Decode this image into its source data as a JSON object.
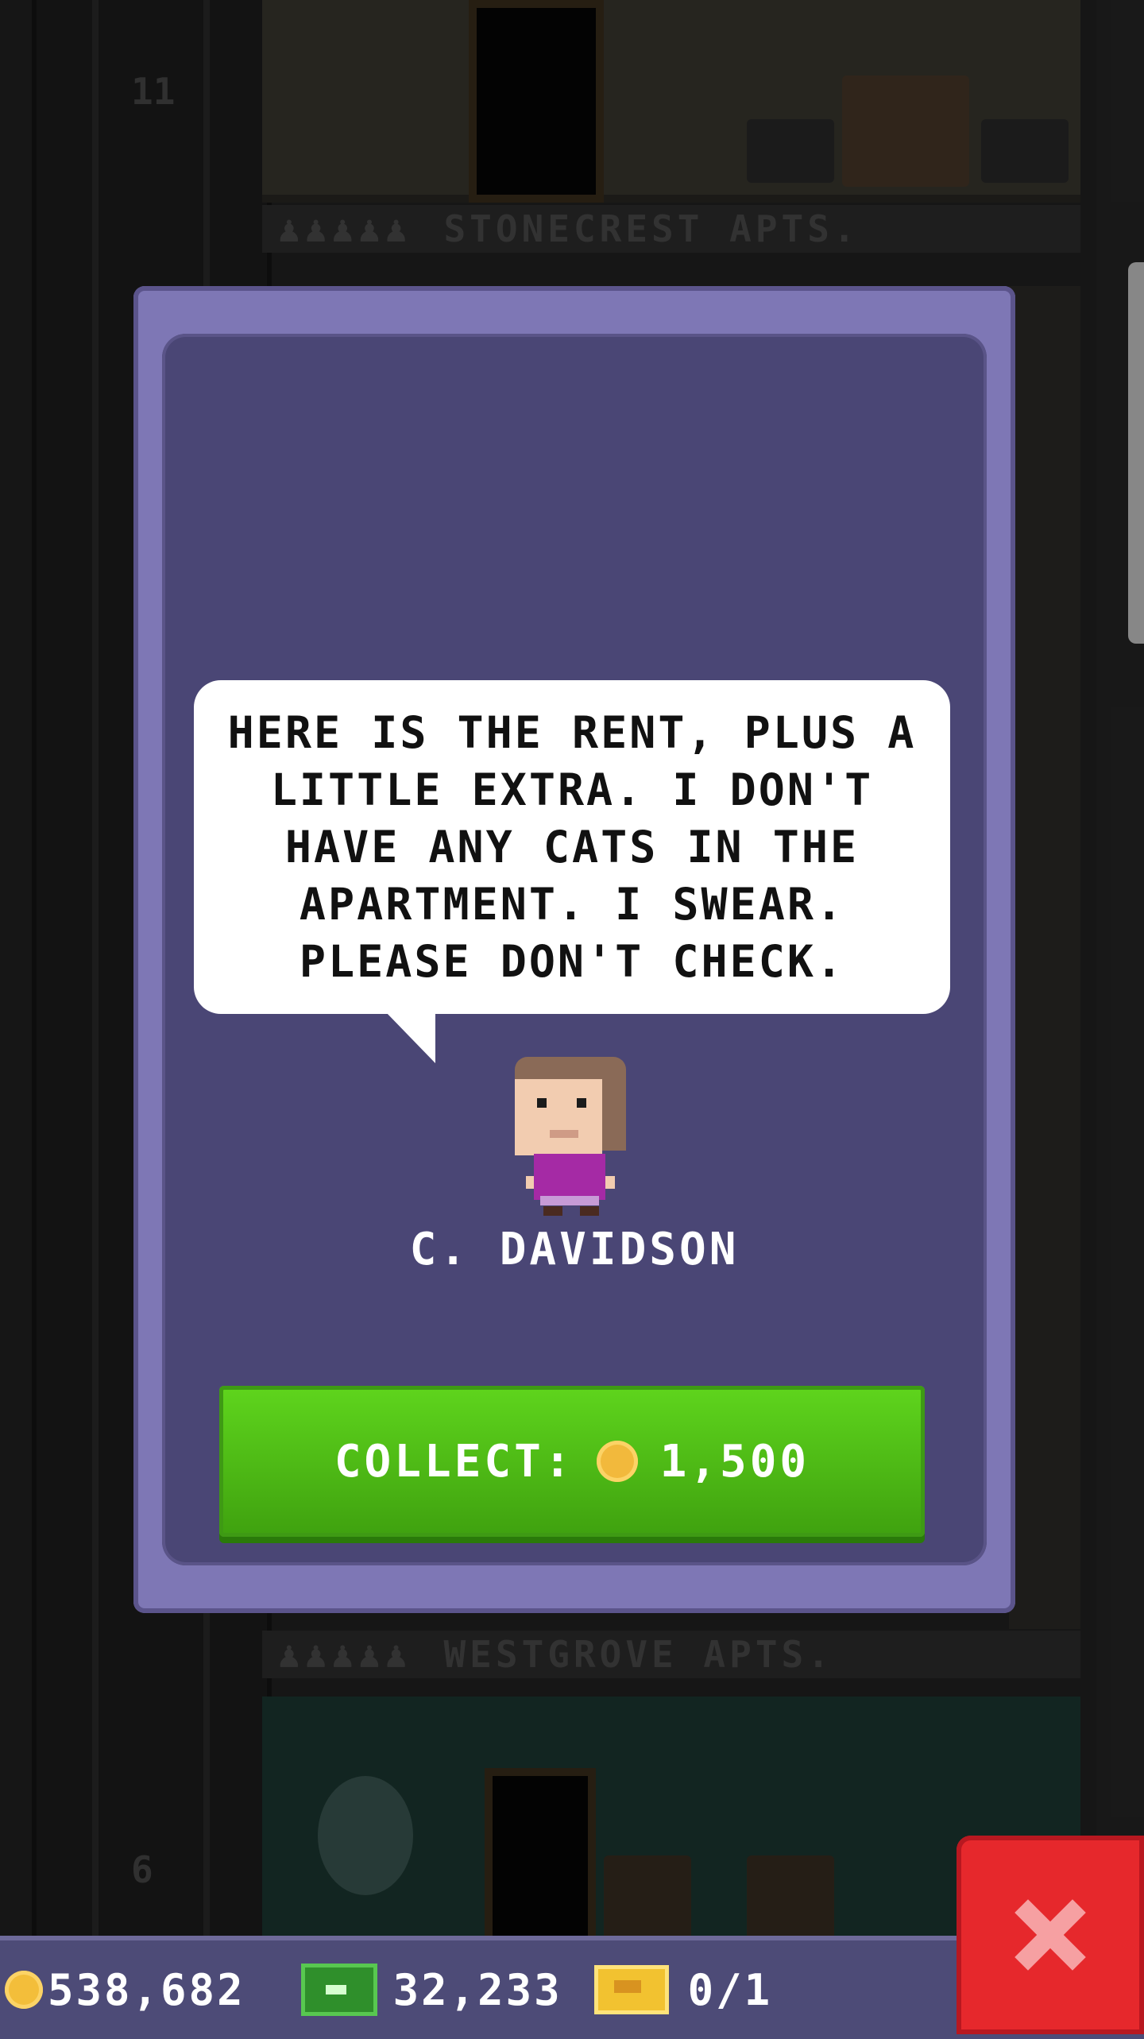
{
  "tower": {
    "floor_top_number": "11",
    "floor_bottom_number": "6",
    "sign_top": "STONECREST APTS.",
    "sign_bottom": "WESTGROVE APTS.",
    "people_glyphs": "♟♟♟♟♟"
  },
  "dialog": {
    "speech": "HERE IS THE RENT, PLUS A LITTLE EXTRA. I DON'T HAVE ANY CATS IN THE APARTMENT. I SWEAR. PLEASE DON'T CHECK.",
    "tenant_name": "C. DAVIDSON",
    "collect_label": "COLLECT:",
    "collect_amount": "1,500"
  },
  "status": {
    "coins": "538,682",
    "bux": "32,233",
    "tickets": "0/1"
  },
  "icons": {
    "close": "close-icon",
    "coin": "coin-icon",
    "bux": "bux-icon",
    "ticket": "golden-ticket-icon"
  },
  "colors": {
    "panel": "#7e77b5",
    "panel_inner": "#4a4675",
    "collect_button": "#4fbd16",
    "close_button": "#e6282c",
    "status_bar": "#4d4b77"
  }
}
